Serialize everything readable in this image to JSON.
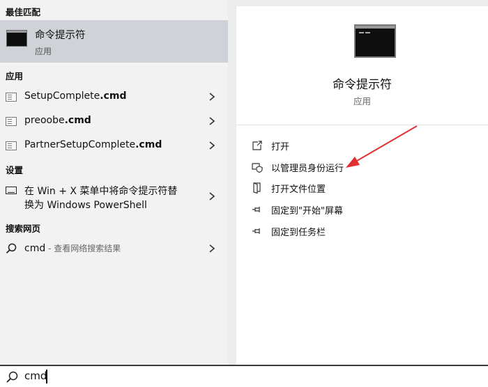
{
  "sections": {
    "best_match": "最佳匹配",
    "apps": "应用",
    "settings": "设置",
    "web": "搜索网页"
  },
  "best_match": {
    "title": "命令提示符",
    "subtitle": "应用"
  },
  "apps": [
    {
      "name": "SetupComplete",
      "ext": ".cmd"
    },
    {
      "name": "preoobe",
      "ext": ".cmd"
    },
    {
      "name": "PartnerSetupComplete",
      "ext": ".cmd"
    }
  ],
  "settings_item": {
    "line1": "在 Win + X 菜单中将命令提示符替",
    "line2": "换为 Windows PowerShell"
  },
  "web_item": {
    "query": "cmd",
    "hint": " - 查看网络搜索结果"
  },
  "detail": {
    "title": "命令提示符",
    "subtitle": "应用",
    "actions": [
      {
        "label": "打开",
        "icon": "open-icon"
      },
      {
        "label": "以管理员身份运行",
        "icon": "shield-icon"
      },
      {
        "label": "打开文件位置",
        "icon": "folder-icon"
      },
      {
        "label": "固定到\"开始\"屏幕",
        "icon": "pin-icon"
      },
      {
        "label": "固定到任务栏",
        "icon": "pin-icon"
      }
    ]
  },
  "search": {
    "value": "cmd"
  },
  "colors": {
    "annotation_arrow": "#e03030",
    "selected": "#cfd3d8"
  }
}
